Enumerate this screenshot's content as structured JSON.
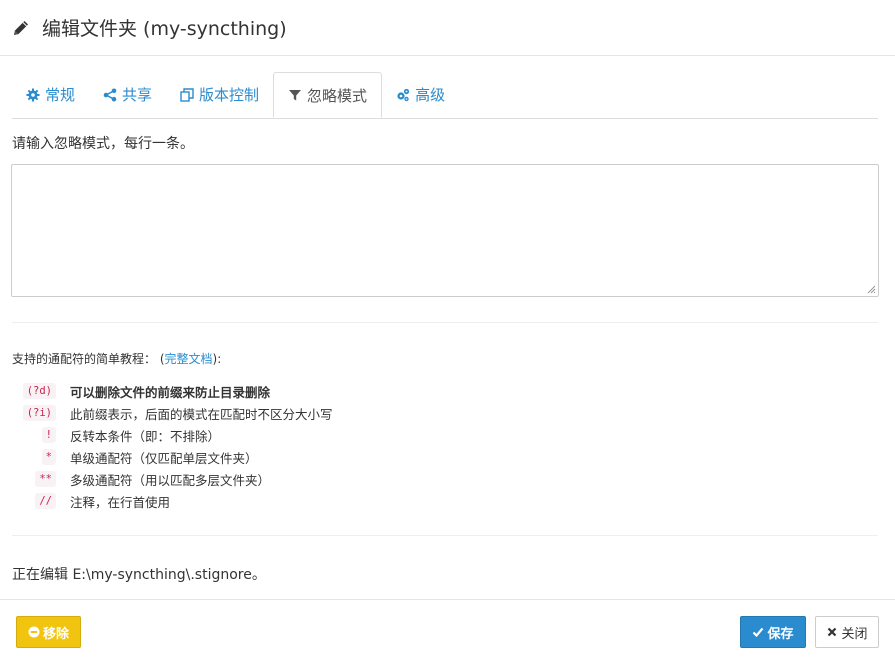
{
  "header": {
    "title": "编辑文件夹 (my-syncthing)",
    "icon": "pencil-icon"
  },
  "tabs": [
    {
      "label": "常规",
      "icon": "gear-icon",
      "active": false
    },
    {
      "label": "共享",
      "icon": "share-icon",
      "active": false
    },
    {
      "label": "版本控制",
      "icon": "versions-icon",
      "active": false
    },
    {
      "label": "忽略模式",
      "icon": "filter-icon",
      "active": true
    },
    {
      "label": "高级",
      "icon": "gears-icon",
      "active": false
    }
  ],
  "ignore": {
    "prompt": "请输入忽略模式，每行一条。",
    "patterns_value": ""
  },
  "help": {
    "intro": "支持的通配符的简单教程：",
    "link_open": "(",
    "link_label": "完整文档",
    "link_close": "):",
    "rules": [
      {
        "code": "(?d)",
        "desc": "可以删除文件的前缀来防止目录删除",
        "bold": true
      },
      {
        "code": "(?i)",
        "desc": "此前缀表示，后面的模式在匹配时不区分大小写",
        "bold": false
      },
      {
        "code": "!",
        "desc": "反转本条件（即：不排除）",
        "bold": false
      },
      {
        "code": "*",
        "desc": "单级通配符（仅匹配单层文件夹）",
        "bold": false
      },
      {
        "code": "**",
        "desc": "多级通配符（用以匹配多层文件夹）",
        "bold": false
      },
      {
        "code": "//",
        "desc": "注释，在行首使用",
        "bold": false
      }
    ]
  },
  "editing": "正在编辑 E:\\my-syncthing\\.stignore。",
  "footer": {
    "remove_label": "移除",
    "save_label": "保存",
    "close_label": "关闭"
  },
  "colors": {
    "accent": "#2a8ccf",
    "warning": "#f1c40f",
    "code": "#c7254e"
  }
}
